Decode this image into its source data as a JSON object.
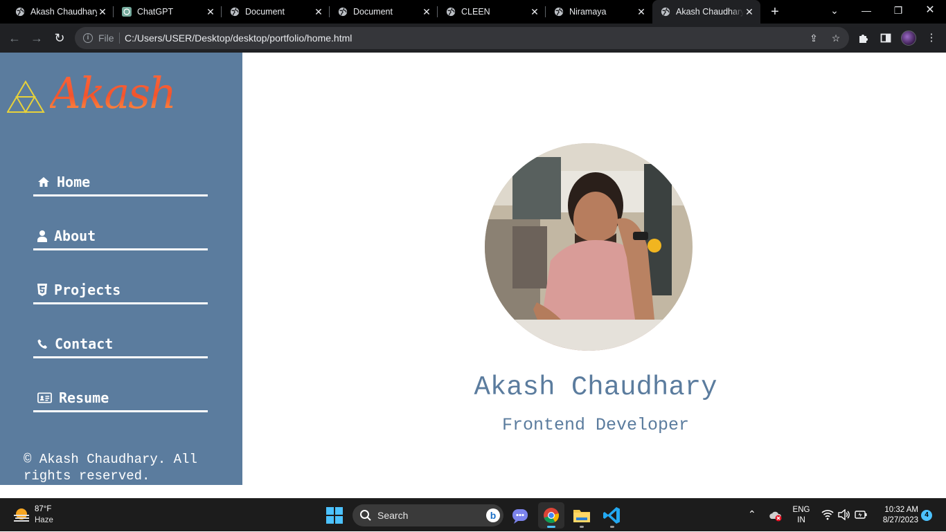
{
  "browser": {
    "tabs": [
      {
        "title": "Akash Chaudhary",
        "icon": "globe-icon"
      },
      {
        "title": "ChatGPT",
        "icon": "chatgpt-icon"
      },
      {
        "title": "Document",
        "icon": "globe-icon"
      },
      {
        "title": "Document",
        "icon": "globe-icon"
      },
      {
        "title": "CLEEN",
        "icon": "globe-icon"
      },
      {
        "title": "Niramaya",
        "icon": "globe-icon"
      },
      {
        "title": "Akash Chaudhary",
        "icon": "globe-icon",
        "active": true
      }
    ],
    "address": {
      "scheme": "File",
      "url": "C:/Users/USER/Desktop/desktop/portfolio/home.html"
    }
  },
  "sidebar": {
    "logo_text": "Akash",
    "nav": [
      {
        "label": "Home",
        "icon": "home-icon"
      },
      {
        "label": "About",
        "icon": "user-icon"
      },
      {
        "label": "Projects",
        "icon": "html5-icon"
      },
      {
        "label": "Contact",
        "icon": "phone-icon"
      },
      {
        "label": "Resume",
        "icon": "id-card-icon"
      }
    ],
    "copyright": "© Akash Chaudhary. All rights reserved."
  },
  "hero": {
    "name": "Akash Chaudhary",
    "role": "Frontend Developer"
  },
  "taskbar": {
    "weather": {
      "temp": "87°F",
      "condition": "Haze"
    },
    "search_placeholder": "Search",
    "bing_label": "b",
    "language": {
      "line1": "ENG",
      "line2": "IN"
    },
    "time": "10:32 AM",
    "date": "8/27/2023",
    "notification_count": "4"
  },
  "colors": {
    "sidebar_bg": "#5b7c9e",
    "accent_text": "#5b7c9e",
    "logo_orange": "#f2542d",
    "logo_triangle": "#e8d23a"
  }
}
